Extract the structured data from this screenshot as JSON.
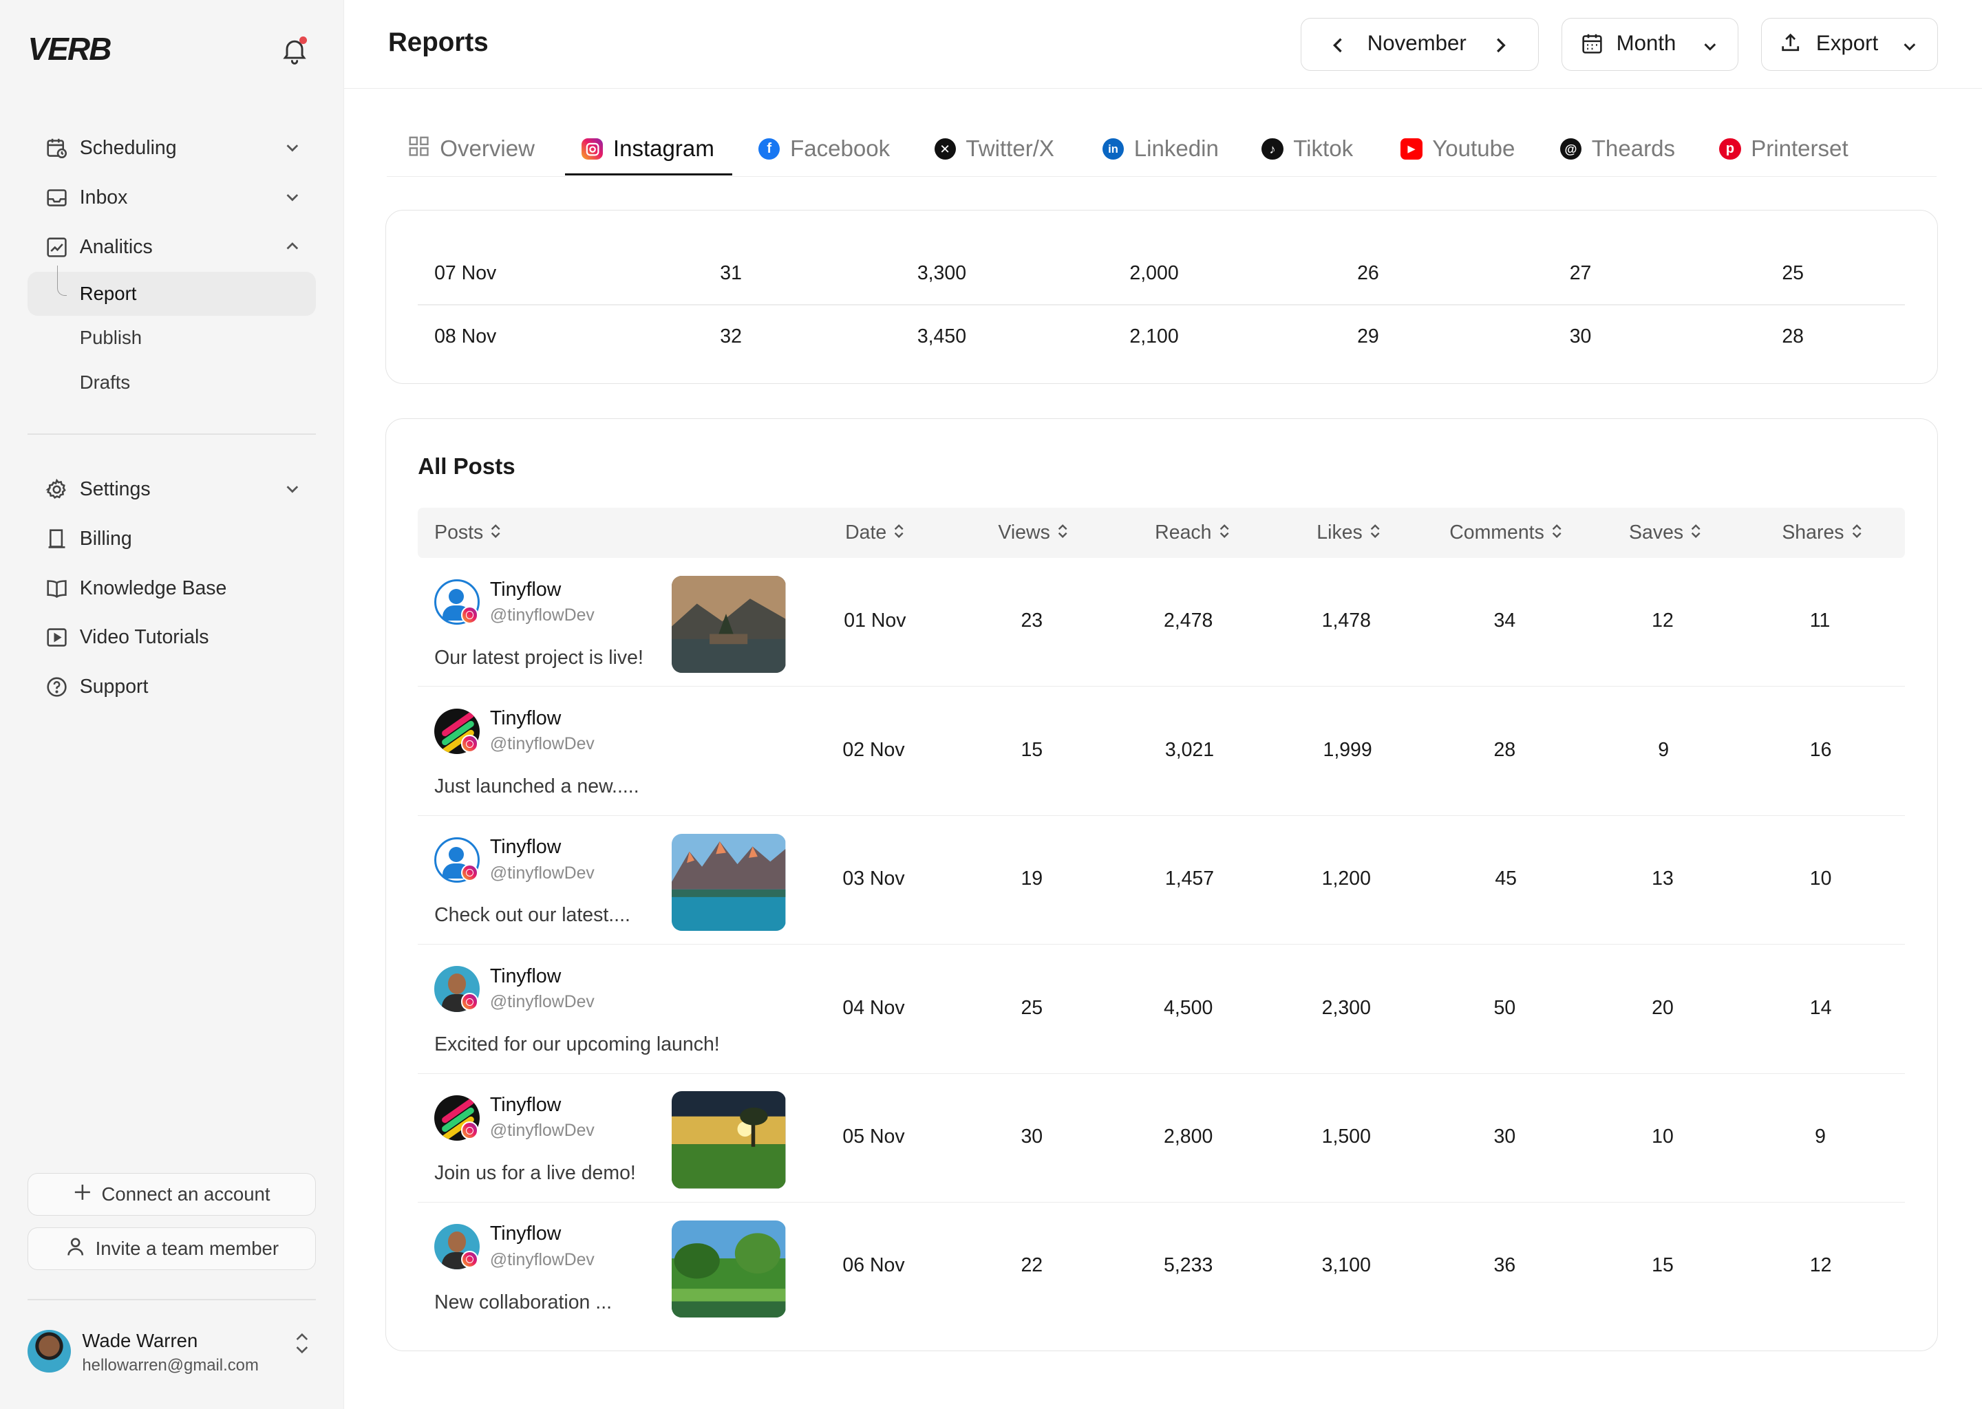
{
  "app": {
    "logo": "VERB"
  },
  "sidebar": {
    "nav": [
      {
        "label": "Scheduling",
        "icon": "calendar-clock-icon",
        "chevron": "down"
      },
      {
        "label": "Inbox",
        "icon": "inbox-icon",
        "chevron": "down"
      },
      {
        "label": "Analitics",
        "icon": "chart-icon",
        "chevron": "up"
      }
    ],
    "analytics_sub": [
      "Report",
      "Publish",
      "Drafts"
    ],
    "nav2": [
      {
        "label": "Settings",
        "icon": "gear-icon",
        "chevron": "down"
      },
      {
        "label": "Billing",
        "icon": "receipt-icon"
      },
      {
        "label": "Knowledge Base",
        "icon": "book-icon"
      },
      {
        "label": "Video Tutorials",
        "icon": "play-icon"
      },
      {
        "label": "Support",
        "icon": "help-icon"
      }
    ],
    "connect_label": "Connect an account",
    "invite_label": "Invite a team member",
    "user": {
      "name": "Wade Warren",
      "email": "hellowarren@gmail.com"
    }
  },
  "header": {
    "title": "Reports",
    "month": "November",
    "period": "Month",
    "export": "Export"
  },
  "tabs": [
    "Overview",
    "Instagram",
    "Facebook",
    "Twitter/X",
    "Linkedin",
    "Tiktok",
    "Youtube",
    "Theards",
    "Printerset"
  ],
  "daily": [
    [
      "07 Nov",
      "31",
      "3,300",
      "2,000",
      "26",
      "27",
      "25"
    ],
    [
      "08 Nov",
      "32",
      "3,450",
      "2,100",
      "29",
      "30",
      "28"
    ]
  ],
  "posts": {
    "title": "All Posts",
    "columns": [
      "Posts",
      "Date",
      "Views",
      "Reach",
      "Likes",
      "Comments",
      "Saves",
      "Shares"
    ],
    "rows": [
      {
        "name": "Tinyflow",
        "handle": "@tinyflowDev",
        "caption": "Our latest project is live!",
        "date": "01 Nov",
        "views": "23",
        "reach": "2,478",
        "likes": "1,478",
        "comments": "34",
        "saves": "12",
        "shares": "11"
      },
      {
        "name": "Tinyflow",
        "handle": "@tinyflowDev",
        "caption": "Just launched a new.....",
        "date": "02 Nov",
        "views": "15",
        "reach": "3,021",
        "likes": "1,999",
        "comments": "28",
        "saves": "9",
        "shares": "16"
      },
      {
        "name": "Tinyflow",
        "handle": "@tinyflowDev",
        "caption": "Check out our latest....",
        "date": "03 Nov",
        "views": "19",
        "reach": "1,457",
        "likes": "1,200",
        "comments": "45",
        "saves": "13",
        "shares": "10"
      },
      {
        "name": "Tinyflow",
        "handle": "@tinyflowDev",
        "caption": "Excited for our upcoming launch!",
        "date": "04 Nov",
        "views": "25",
        "reach": "4,500",
        "likes": "2,300",
        "comments": "50",
        "saves": "20",
        "shares": "14"
      },
      {
        "name": "Tinyflow",
        "handle": "@tinyflowDev",
        "caption": "Join us for a live demo!",
        "date": "05 Nov",
        "views": "30",
        "reach": "2,800",
        "likes": "1,500",
        "comments": "30",
        "saves": "10",
        "shares": "9"
      },
      {
        "name": "Tinyflow",
        "handle": "@tinyflowDev",
        "caption": "New collaboration ...",
        "date": "06 Nov",
        "views": "22",
        "reach": "5,233",
        "likes": "3,100",
        "comments": "36",
        "saves": "15",
        "shares": "12"
      }
    ]
  }
}
